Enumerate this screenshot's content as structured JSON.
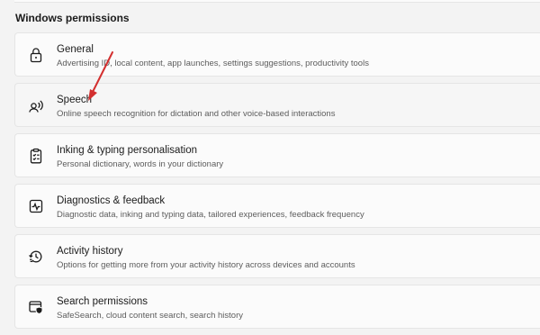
{
  "section": {
    "title": "Windows permissions"
  },
  "items": [
    {
      "icon": "lock-icon",
      "label": "General",
      "description": "Advertising ID, local content, app launches, settings suggestions, productivity tools"
    },
    {
      "icon": "speech-icon",
      "label": "Speech",
      "description": "Online speech recognition for dictation and other voice-based interactions"
    },
    {
      "icon": "clipboard-icon",
      "label": "Inking & typing personalisation",
      "description": "Personal dictionary, words in your dictionary"
    },
    {
      "icon": "diagnostics-icon",
      "label": "Diagnostics & feedback",
      "description": "Diagnostic data, inking and typing data, tailored experiences, feedback frequency"
    },
    {
      "icon": "history-icon",
      "label": "Activity history",
      "description": "Options for getting more from your activity history across devices and accounts"
    },
    {
      "icon": "search-permissions-icon",
      "label": "Search permissions",
      "description": "SafeSearch, cloud content search, search history"
    }
  ],
  "annotation": {
    "color": "#d32f2f"
  }
}
